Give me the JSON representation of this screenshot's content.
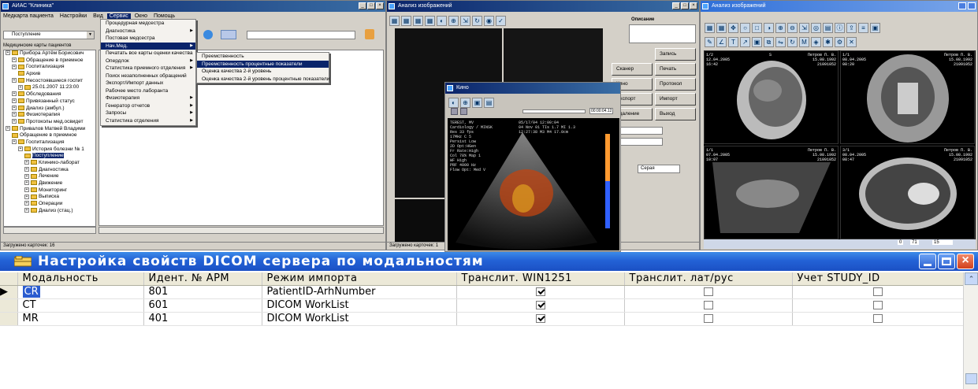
{
  "main_window": {
    "title": "АИАС \"Клиника\"",
    "menu": [
      "Медкарта пациента",
      "Настройки",
      "Вид",
      "Сервис",
      "Окно",
      "Помощь"
    ],
    "combo_value": "Поступление",
    "tree_header": "Медицинские карты пациентов",
    "tree": [
      "Прибора Артём Борисович",
      "Обращение в приемное",
      "Госпитализация",
      "Архив",
      "Несостоявшиеся госпит",
      "25.01.2007 11:23:00",
      "Обследования",
      "Привязанный статус",
      "Диализ (амбул.)",
      "Физиотерапия",
      "Протоколы мед.освидет",
      "Привалов Матвей Владими",
      "Обращение в приемное",
      "Госпитализация",
      "История болезни № 1",
      "Поступление",
      "Клинико-лаборат",
      "Диагностика",
      "Лечение",
      "Движение",
      "Мониторинг",
      "Выписка",
      "Операции",
      "Диализ (стац.)"
    ],
    "status": "Загружено карточек: 16"
  },
  "service_menu": {
    "items": [
      "Процедурная медсестра",
      "Диагностика",
      "Постовая медсестра",
      "Нач.Мед.",
      "Печатать все карты оценки качества",
      "Опердлок",
      "Статистика приемного отделения",
      "Поиск незаполненных обращений",
      "Экспорт/Импорт данных",
      "Рабочее место лаборанта",
      "Физиотерапия",
      "Генератор отчетов",
      "Запросы",
      "Статистика отделения"
    ],
    "highlighted": "Нач.Мед."
  },
  "submenu": {
    "items": [
      "Преемственность",
      "Преемственность процентные показатели",
      "Оценка качества 2-й уровень",
      "Оценка качества 2-й уровень процентные показатели"
    ],
    "highlighted": "Преемственность процентные показатели"
  },
  "viewer_window": {
    "title": "Анализ изображений",
    "description_label": "Описание",
    "buttons": [
      "Запись",
      "Сканер",
      "Печать",
      "Кино",
      "Протокол",
      "Экспорт",
      "Импорт",
      "Удаление",
      "Выход"
    ],
    "palette_value": "Серая",
    "status": "Загружено карточек: 1"
  },
  "cine_window": {
    "title": "Кино",
    "frame_counter": "00:00:04.12",
    "overlay_left": [
      "TEREST, MV",
      "Cardiology / MINSK",
      "Res 33 fps",
      "17MHz C 5",
      "Persist Low",
      "2D Opt:HGen",
      "Fr Rate:High",
      "Col 78%  Map 1",
      "WF High",
      "PRF 4000 Hz",
      "Flow Opt: Med V"
    ],
    "overlay_top": [
      "05/17/04 12:00:04",
      "04 Nov 01   TIs 1.7   MI 1.3",
      "12:27:38   M3   M4   17.0cm"
    ],
    "size_label": "720x576"
  },
  "analysis_window": {
    "title": "Анализ изображений",
    "panels": [
      {
        "left": [
          "1/2",
          "12.04.2005",
          "16:42"
        ],
        "center": "S",
        "right": [
          "Петров П. В.",
          "15.08.1992",
          "21091052"
        ]
      },
      {
        "left": [
          "1/1",
          "08.04.2005",
          "08:20"
        ],
        "center": "",
        "right": [
          "Петров П. В.",
          "15.08.1992",
          "21091052"
        ]
      },
      {
        "left": [
          "1/1",
          "07.04.2005",
          "10:07"
        ],
        "center": "",
        "right": [
          "Петров П. В.",
          "15.08.1992",
          "21091052"
        ]
      },
      {
        "left": [
          "3/1",
          "08.04.2005",
          "08:47"
        ],
        "center": "",
        "right": [
          "Петров П. В.",
          "15.08.1992",
          "21091052"
        ]
      }
    ],
    "bottom_values": [
      "0",
      "71",
      "15"
    ]
  },
  "dicom_dialog": {
    "title": "Настройка свойств DICOM сервера по модальностям",
    "columns": [
      "Модальность",
      "Идент. № АРМ",
      "Режим импорта",
      "Транслит. WIN1251",
      "Транслит. лат/рус",
      "Учет STUDY_ID"
    ],
    "rows": [
      {
        "modality": "CR",
        "arm": "801",
        "mode": "PatientID-ArhNumber",
        "win1251": true,
        "latrus": false,
        "study": false
      },
      {
        "modality": "CT",
        "arm": "601",
        "mode": "DICOM WorkList",
        "win1251": true,
        "latrus": false,
        "study": false
      },
      {
        "modality": "MR",
        "arm": "401",
        "mode": "DICOM WorkList",
        "win1251": true,
        "latrus": false,
        "study": false
      }
    ],
    "accent_color": "#2362d6"
  }
}
